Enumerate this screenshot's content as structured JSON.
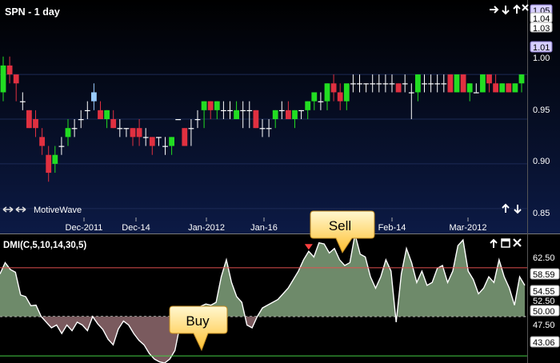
{
  "price_panel": {
    "title": "SPN - 1 day",
    "nav_icons": [
      "arrow-right-icon",
      "arrow-down-icon",
      "arrow-up-icon",
      "close-icon"
    ],
    "branding": "MotiveWave",
    "y_ticks": [
      "1.05",
      "1.04",
      "1.03",
      "1.01",
      "1.00",
      "0.95",
      "0.90",
      "0.85"
    ],
    "highlighted_ticks": [
      "1.05",
      "1.01"
    ],
    "x_ticks": [
      "Dec-2011",
      "Dec-14",
      "Jan-2012",
      "Jan-16",
      "Feb-14",
      "Mar-2012"
    ],
    "colors": {
      "up": "#22dd22",
      "down": "#e03040",
      "neutral": "#ffffff",
      "highlight": "#99ccff"
    }
  },
  "indicator_panel": {
    "title": "DMI(C,5,10,14,30,5)",
    "y_ticks": [
      "62.50",
      "58.59",
      "54.55",
      "52.50",
      "50.00",
      "47.50",
      "43.06"
    ],
    "boxed_ticks": [
      "58.59",
      "54.55",
      "50.00",
      "43.06"
    ],
    "upper_level": 58.59,
    "lower_level": 43.06,
    "mid_level": 50.0,
    "colors": {
      "above": "#6e8a6a",
      "below": "#7a5a5e",
      "upper_line": "#e05050",
      "lower_line": "#44cc44"
    }
  },
  "callouts": {
    "sell": "Sell",
    "buy": "Buy"
  },
  "chart_data": [
    {
      "type": "candlestick",
      "title": "SPN - 1 day",
      "ylim": [
        0.84,
        1.06
      ],
      "x_tick_labels": [
        "Dec-2011",
        "Dec-14",
        "Jan-2012",
        "Jan-16",
        "Feb-14",
        "Mar-2012"
      ],
      "candles": [
        [
          0.98,
          1.02,
          0.97,
          1.01
        ],
        [
          1.01,
          1.02,
          0.99,
          1.0
        ],
        [
          1.0,
          1.0,
          0.97,
          0.99
        ],
        [
          0.97,
          0.98,
          0.96,
          0.97
        ],
        [
          0.96,
          0.96,
          0.94,
          0.94
        ],
        [
          0.95,
          0.96,
          0.93,
          0.94
        ],
        [
          0.93,
          0.94,
          0.91,
          0.92
        ],
        [
          0.91,
          0.92,
          0.88,
          0.89
        ],
        [
          0.9,
          0.92,
          0.89,
          0.91
        ],
        [
          0.92,
          0.93,
          0.91,
          0.92
        ],
        [
          0.93,
          0.95,
          0.92,
          0.94
        ],
        [
          0.94,
          0.95,
          0.93,
          0.94
        ],
        [
          0.95,
          0.96,
          0.94,
          0.95
        ],
        [
          0.96,
          0.97,
          0.95,
          0.96
        ],
        [
          0.97,
          0.99,
          0.96,
          0.98
        ],
        [
          0.96,
          0.97,
          0.95,
          0.95
        ],
        [
          0.95,
          0.96,
          0.94,
          0.96
        ],
        [
          0.95,
          0.96,
          0.94,
          0.94
        ],
        [
          0.94,
          0.95,
          0.93,
          0.94
        ],
        [
          0.94,
          0.94,
          0.93,
          0.94
        ],
        [
          0.94,
          0.94,
          0.92,
          0.93
        ],
        [
          0.94,
          0.95,
          0.92,
          0.93
        ],
        [
          0.93,
          0.94,
          0.92,
          0.93
        ],
        [
          0.93,
          0.93,
          0.91,
          0.92
        ],
        [
          0.93,
          0.93,
          0.92,
          0.93
        ],
        [
          0.92,
          0.93,
          0.91,
          0.92
        ],
        [
          0.92,
          0.93,
          0.91,
          0.93
        ],
        [
          0.95,
          0.95,
          0.95,
          0.95
        ],
        [
          0.94,
          0.94,
          0.92,
          0.92
        ],
        [
          0.94,
          0.95,
          0.92,
          0.94
        ],
        [
          0.95,
          0.96,
          0.94,
          0.95
        ],
        [
          0.96,
          0.97,
          0.94,
          0.97
        ],
        [
          0.97,
          0.97,
          0.95,
          0.96
        ],
        [
          0.96,
          0.97,
          0.95,
          0.97
        ],
        [
          0.96,
          0.97,
          0.95,
          0.96
        ],
        [
          0.96,
          0.97,
          0.95,
          0.96
        ],
        [
          0.95,
          0.97,
          0.95,
          0.96
        ],
        [
          0.96,
          0.97,
          0.94,
          0.96
        ],
        [
          0.96,
          0.97,
          0.94,
          0.96
        ],
        [
          0.96,
          0.96,
          0.94,
          0.94
        ],
        [
          0.94,
          0.95,
          0.93,
          0.94
        ],
        [
          0.94,
          0.95,
          0.93,
          0.94
        ],
        [
          0.95,
          0.96,
          0.94,
          0.96
        ],
        [
          0.96,
          0.97,
          0.95,
          0.96
        ],
        [
          0.96,
          0.97,
          0.95,
          0.95
        ],
        [
          0.95,
          0.96,
          0.94,
          0.96
        ],
        [
          0.96,
          0.96,
          0.95,
          0.96
        ],
        [
          0.96,
          0.97,
          0.95,
          0.97
        ],
        [
          0.97,
          0.98,
          0.96,
          0.98
        ],
        [
          0.97,
          0.98,
          0.96,
          0.97
        ],
        [
          0.97,
          0.99,
          0.96,
          0.99
        ],
        [
          0.99,
          1.0,
          0.97,
          0.98
        ],
        [
          0.98,
          0.99,
          0.96,
          0.97
        ],
        [
          0.97,
          0.98,
          0.96,
          0.99
        ],
        [
          0.99,
          1.0,
          0.98,
          0.99
        ],
        [
          0.99,
          1.0,
          0.98,
          0.99
        ],
        [
          0.99,
          0.99,
          0.98,
          0.99
        ],
        [
          0.99,
          1.0,
          0.98,
          0.99
        ],
        [
          0.99,
          1.0,
          0.98,
          0.99
        ],
        [
          0.99,
          1.0,
          0.98,
          0.99
        ],
        [
          0.99,
          1.0,
          0.98,
          0.99
        ],
        [
          0.99,
          0.99,
          0.98,
          0.98
        ],
        [
          0.99,
          1.0,
          0.98,
          0.99
        ],
        [
          0.98,
          0.99,
          0.95,
          0.98
        ],
        [
          0.98,
          1.0,
          0.97,
          1.0
        ],
        [
          0.99,
          1.0,
          0.98,
          0.99
        ],
        [
          0.99,
          1.0,
          0.98,
          0.99
        ],
        [
          0.99,
          1.0,
          0.98,
          0.99
        ],
        [
          0.99,
          1.0,
          0.98,
          0.99
        ],
        [
          1.0,
          1.0,
          0.98,
          0.98
        ],
        [
          0.98,
          1.0,
          0.98,
          1.0
        ],
        [
          1.0,
          1.0,
          0.98,
          0.98
        ],
        [
          0.98,
          0.99,
          0.97,
          0.99
        ],
        [
          0.98,
          0.99,
          0.98,
          0.98
        ],
        [
          0.98,
          1.0,
          0.98,
          1.0
        ],
        [
          1.0,
          1.0,
          0.98,
          0.99
        ],
        [
          0.99,
          1.0,
          0.98,
          0.98
        ],
        [
          0.98,
          0.99,
          0.98,
          0.99
        ],
        [
          0.99,
          0.99,
          0.98,
          0.98
        ],
        [
          0.98,
          0.99,
          0.98,
          0.99
        ],
        [
          0.99,
          1.0,
          0.98,
          1.0
        ]
      ]
    },
    {
      "type": "area",
      "title": "DMI(C,5,10,14,30,5)",
      "ylim": [
        41.8,
        64.5
      ],
      "baseline": 50.0,
      "levels": [
        58.59,
        43.06
      ],
      "values": [
        57.5,
        59.5,
        58.3,
        57.8,
        53.8,
        53.5,
        51.9,
        52.0,
        50.0,
        49.0,
        48.0,
        48.5,
        47.0,
        48.5,
        47.5,
        49.0,
        48.5,
        47.5,
        50.0,
        48.7,
        47.7,
        46.0,
        45.0,
        47.8,
        49.2,
        48.5,
        47.0,
        45.8,
        45.0,
        43.5,
        42.5,
        42.0,
        41.8,
        42.5,
        44.0,
        48.5,
        50.0,
        50.8,
        51.5,
        51.8,
        52.2,
        52.0,
        52.5,
        57.0,
        60.0,
        56.0,
        53.5,
        52.5,
        48.5,
        48.0,
        50.0,
        51.5,
        52.0,
        52.5,
        53.0,
        54.0,
        55.0,
        56.5,
        58.0,
        60.0,
        61.5,
        60.5,
        63.0,
        62.8,
        61.2,
        62.0,
        60.0,
        59.0,
        59.5,
        64.5,
        61.0,
        60.5,
        57.0,
        55.0,
        57.0,
        60.0,
        58.0,
        49.0,
        57.5,
        62.0,
        59.5,
        56.0,
        58.0,
        55.5,
        56.0,
        58.5,
        59.0,
        56.0,
        58.0,
        62.5,
        63.5,
        58.0,
        56.5,
        54.0,
        55.0,
        57.0,
        56.0,
        60.0,
        57.0,
        55.0,
        52.0,
        57.0,
        55.5
      ],
      "markers": [
        {
          "label": "Sell",
          "index": 60,
          "direction": "down"
        },
        {
          "label": "Buy",
          "index": 32,
          "direction": "up"
        }
      ]
    }
  ]
}
